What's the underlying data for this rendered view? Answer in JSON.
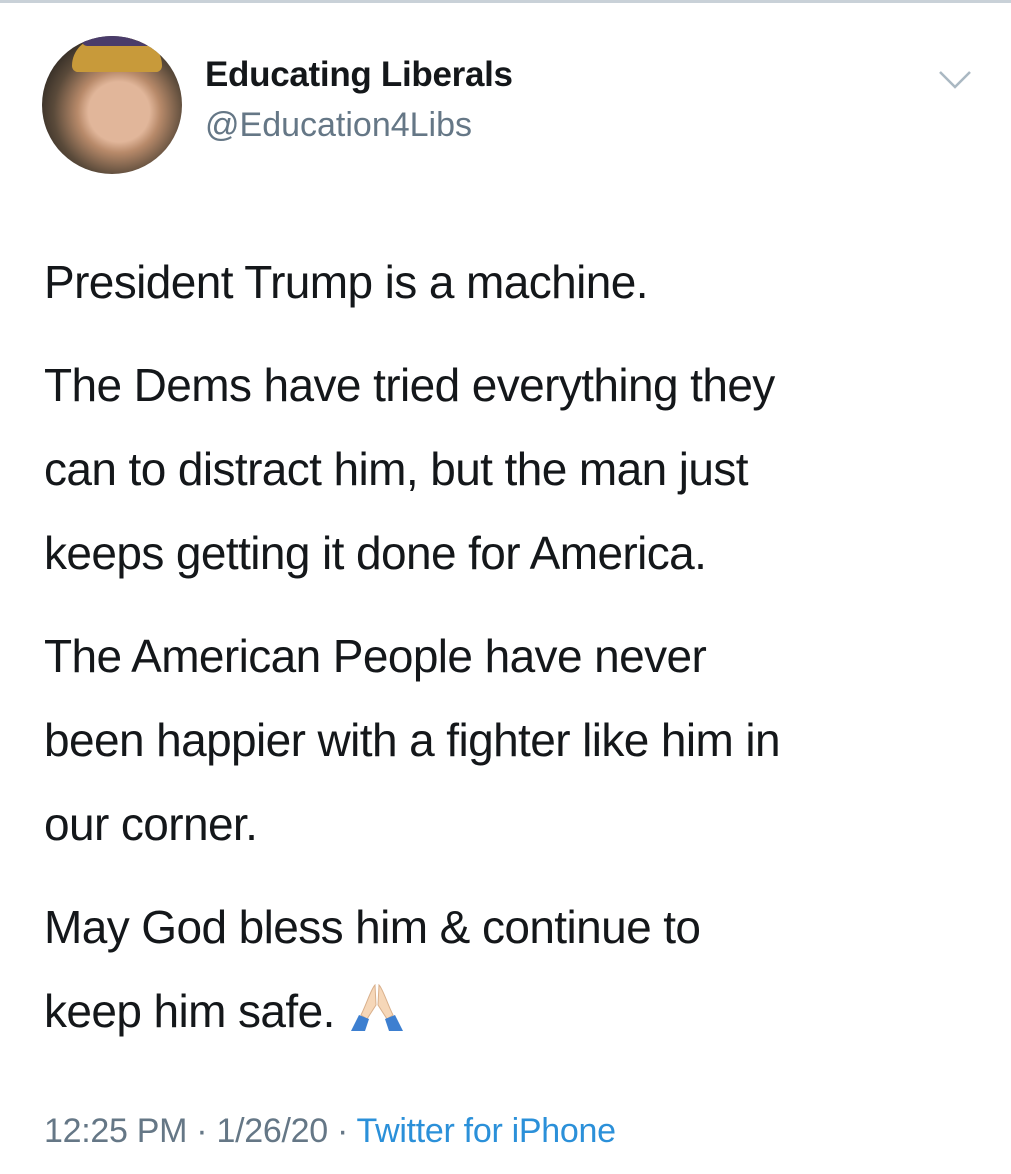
{
  "tweet": {
    "author_name": "Educating Liberals",
    "author_handle": "@Education4Libs",
    "paragraphs": [
      [
        "President Trump is a machine."
      ],
      [
        "The Dems have tried everything they",
        "can to distract him, but the man just",
        "keeps getting it done for America."
      ],
      [
        "The American People have never",
        "been happier with a fighter like him in",
        "our corner."
      ],
      [
        "May God bless him & continue to",
        "keep him safe."
      ]
    ],
    "emoji": "folded-hands",
    "time": "12:25 PM",
    "separator": " · ",
    "date": "1/26/20",
    "source": "Twitter for iPhone"
  },
  "colors": {
    "handle": "#657786",
    "link": "#2b90d9",
    "text": "#14171a"
  }
}
